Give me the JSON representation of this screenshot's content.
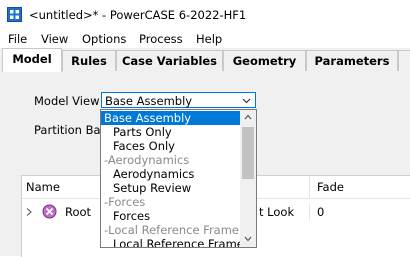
{
  "window": {
    "title": "<untitled>* - PowerCASE 6-2022-HF1"
  },
  "menu": [
    "File",
    "View",
    "Options",
    "Process",
    "Help"
  ],
  "tabs": [
    "Model",
    "Rules",
    "Case Variables",
    "Geometry",
    "Parameters"
  ],
  "model_view": {
    "label": "Model View",
    "selected": "Base Assembly"
  },
  "partition": {
    "label": "Partition Bas"
  },
  "tree": {
    "columns": [
      "Name",
      "Fade"
    ],
    "rows": [
      {
        "name": "Root",
        "look": "t Look",
        "fade": "0"
      }
    ]
  },
  "dropdown": {
    "options": [
      {
        "label": "Base Assembly",
        "kind": "selected"
      },
      {
        "label": "Parts Only",
        "kind": "item"
      },
      {
        "label": "Faces Only",
        "kind": "item"
      },
      {
        "label": "-Aerodynamics",
        "kind": "group"
      },
      {
        "label": "Aerodynamics",
        "kind": "item"
      },
      {
        "label": "Setup Review",
        "kind": "item"
      },
      {
        "label": "-Forces",
        "kind": "group"
      },
      {
        "label": "Forces",
        "kind": "item"
      },
      {
        "label": "-Local Reference Frame",
        "kind": "group"
      },
      {
        "label": "Local Reference Frame",
        "kind": "item"
      }
    ]
  },
  "colors": {
    "accent": "#0078d7",
    "group_text": "#8a8a8a"
  }
}
